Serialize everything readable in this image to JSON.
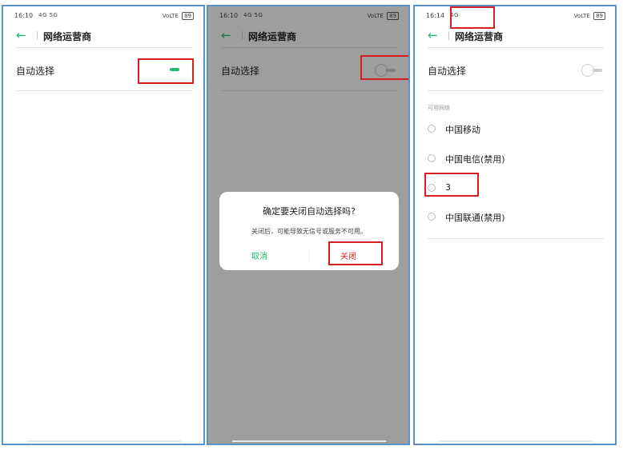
{
  "screens": [
    {
      "status": {
        "time": "16:10",
        "network": "4G 5G",
        "right": "VoLTE",
        "battery": "89"
      },
      "title": "网络运营商",
      "auto_select_label": "自动选择",
      "toggle_state": "on"
    },
    {
      "status": {
        "time": "16:10",
        "network": "4G 5G",
        "right": "VoLTE",
        "battery": "89"
      },
      "title": "网络运营商",
      "auto_select_label": "自动选择",
      "toggle_state": "off",
      "dialog": {
        "title": "确定要关闭自动选择吗?",
        "message": "关闭后，可能导致无信号或服务不可用。",
        "cancel": "取消",
        "confirm": "关闭"
      }
    },
    {
      "status": {
        "time": "16:14",
        "network": "4G",
        "right": "VoLTE",
        "battery": "89"
      },
      "title": "网络运营商",
      "auto_select_label": "自动选择",
      "toggle_state": "off",
      "section_label": "可用网络",
      "networks": [
        "中国移动",
        "中国电信(禁用)",
        "3",
        "中国联通(禁用)"
      ]
    }
  ],
  "colors": {
    "accent": "#1dbd6e",
    "danger": "#e02222",
    "highlight_box": "#d71f1f",
    "panel_border": "#5b93c9"
  }
}
